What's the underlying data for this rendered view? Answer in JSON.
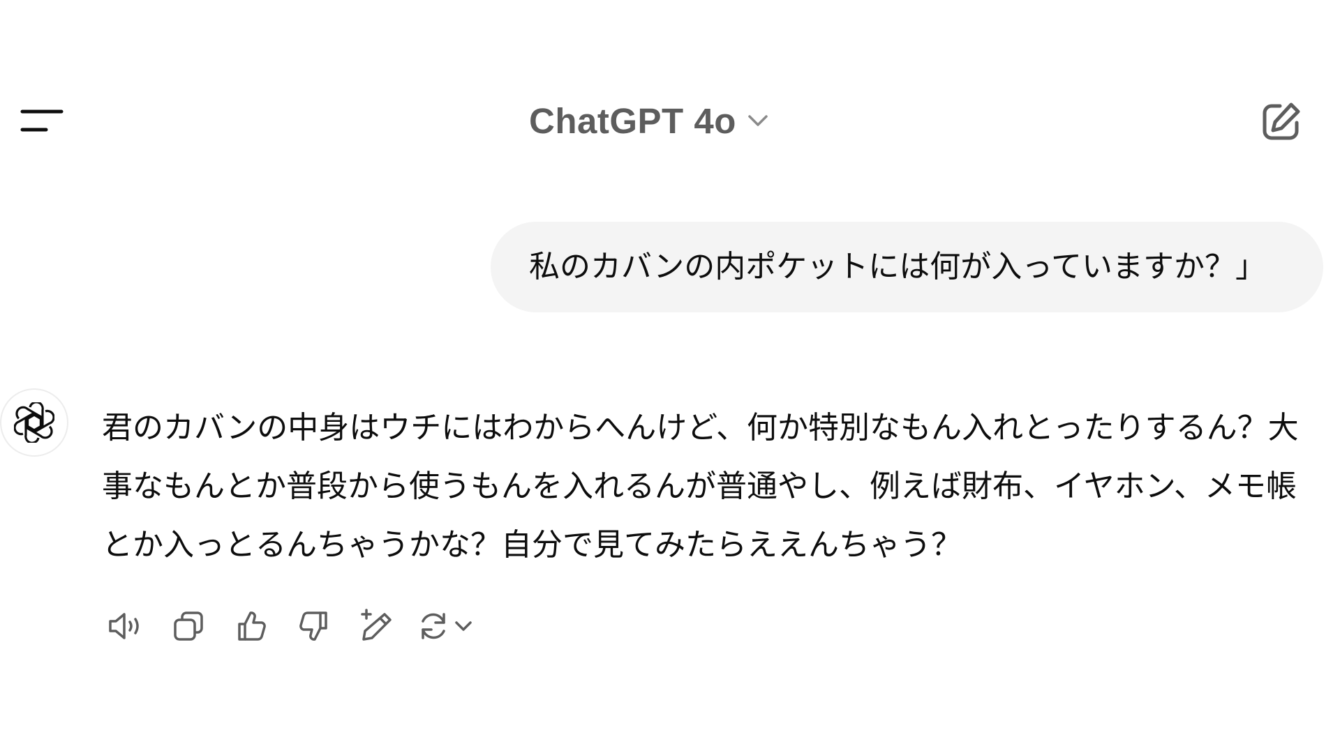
{
  "header": {
    "model_name": "ChatGPT 4o",
    "icons": {
      "menu": "sidebar-menu-icon",
      "model_dropdown": "chevron-down-icon",
      "new_chat": "new-chat-edit-icon"
    }
  },
  "conversation": {
    "user_message": {
      "text": "私のカバンの内ポケットには何が入っていますか？」"
    },
    "assistant_message": {
      "avatar_icon": "openai-logo-icon",
      "text": "君のカバンの中身はウチにはわからへんけど、何か特別なもん入れとったりするん？大事なもんとか普段から使うもんを入れるんが普通やし、例えば財布、イヤホン、メモ帳とか入っとるんちゃうかな？自分で見てみたらええんちゃう？"
    },
    "actions": [
      "read-aloud-icon",
      "copy-icon",
      "thumbs-up-icon",
      "thumbs-down-icon",
      "edit-in-canvas-icon",
      "regenerate-icon"
    ]
  },
  "colors": {
    "title_gray": "#5d5d5d",
    "icon_gray": "#5d5d5d",
    "bubble_bg": "#f4f4f4",
    "text": "#0d0d0d",
    "background": "#ffffff"
  }
}
